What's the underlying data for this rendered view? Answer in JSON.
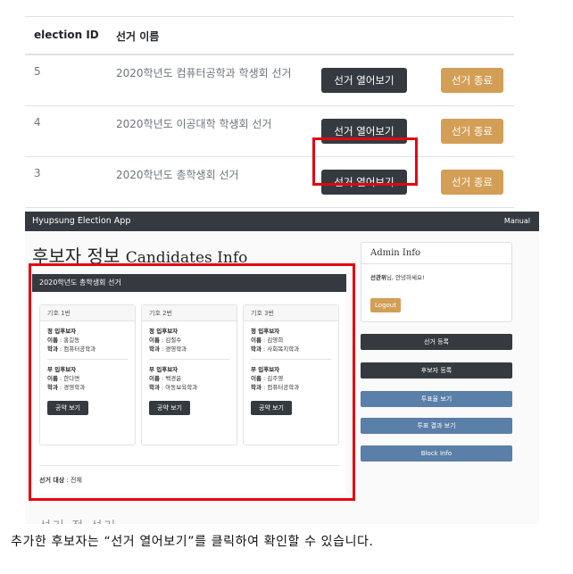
{
  "election_table": {
    "headers": {
      "id": "election ID",
      "name": "선거 이름"
    },
    "rows": [
      {
        "id": "5",
        "name": "2020학년도 컴퓨터공학과 학생회 선거",
        "open_label": "선거 열어보기",
        "end_label": "선거 종료"
      },
      {
        "id": "4",
        "name": "2020학년도 이공대학 학생회 선거",
        "open_label": "선거 열어보기",
        "end_label": "선거 종료"
      },
      {
        "id": "3",
        "name": "2020학년도 총학생회 선거",
        "open_label": "선거 열어보기",
        "end_label": "선거 종료"
      }
    ]
  },
  "app": {
    "brand": "Hyupsung Election App",
    "manual": "Manual",
    "title_ko": "후보자 정보",
    "title_en": "Candidates Info"
  },
  "candidates_panel": {
    "election_name": "2020학년도 총학생회 선거",
    "cards": [
      {
        "number": "기호 1번",
        "main_title": "정 입후보자",
        "main_name_label": "이름",
        "main_name": "홍길동",
        "main_dept_label": "학과",
        "main_dept": "컴퓨터공학과",
        "vice_title": "부 입후보자",
        "vice_name_label": "이름",
        "vice_name": "한다면",
        "vice_dept_label": "학과",
        "vice_dept": "경영학과",
        "pledge_label": "공약 보기"
      },
      {
        "number": "기호 2번",
        "main_title": "정 입후보자",
        "main_name_label": "이름",
        "main_name": "김철수",
        "main_dept_label": "학과",
        "main_dept": "경영학과",
        "vice_title": "부 입후보자",
        "vice_name_label": "이름",
        "vice_name": "백경윤",
        "vice_dept_label": "학과",
        "vice_dept": "아동보육학과",
        "pledge_label": "공약 보기"
      },
      {
        "number": "기호 3번",
        "main_title": "정 입후보자",
        "main_name_label": "이름",
        "main_name": "김영희",
        "main_dept_label": "학과",
        "main_dept": "사회복지학과",
        "vice_title": "부 입후보자",
        "vice_name_label": "이름",
        "vice_name": "김주영",
        "vice_dept_label": "학과",
        "vice_dept": "컴퓨터공학과",
        "pledge_label": "공약 보기"
      }
    ],
    "target_label": "선거 대상",
    "target_value": "전체"
  },
  "admin": {
    "title": "Admin Info",
    "greeting_name": "선관위",
    "greeting_rest": "님, 안녕하세요!",
    "logout": "Logout"
  },
  "sidebar_buttons": [
    {
      "label": "선거 등록",
      "style": "dark"
    },
    {
      "label": "후보자 등록",
      "style": "dark"
    },
    {
      "label": "투표율 보기",
      "style": "blue"
    },
    {
      "label": "투표 결과 보기",
      "style": "blue"
    },
    {
      "label": "Block Info",
      "style": "blue"
    }
  ],
  "partial_text": "선거 정 선거",
  "caption": "추가한 후보자는 “선거 열어보기”를 클릭하여 확인할 수 있습니다.",
  "colors": {
    "highlight": "#e30613",
    "dark_button": "#343a40",
    "end_button": "#d39e56",
    "blue_button": "#5a7fa8"
  }
}
